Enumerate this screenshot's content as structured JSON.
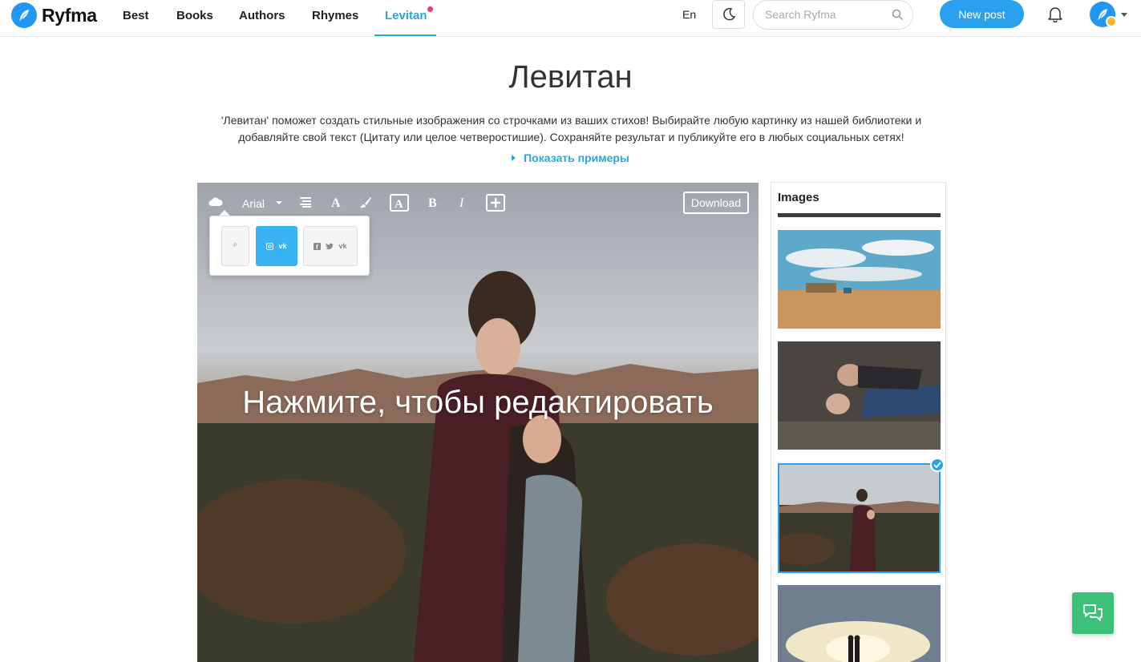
{
  "brand": {
    "name": "Ryfma",
    "accent": "#2aa1ee"
  },
  "nav": {
    "items": [
      {
        "label": "Best"
      },
      {
        "label": "Books"
      },
      {
        "label": "Authors"
      },
      {
        "label": "Rhymes"
      },
      {
        "label": "Levitan"
      }
    ],
    "active": "Levitan",
    "active_color": "#2aa7d9"
  },
  "header": {
    "lang_label": "En",
    "search_placeholder": "Search Ryfma",
    "new_post_label": "New post"
  },
  "page": {
    "title": "Левитан",
    "intro": "'Левитан' поможет создать стильные изображения со строчками из ваших стихов! Выбирайте любую картинку из нашей библиотеки и добавляйте свой текст (Цитату или целое четверостишие). Сохраняйте результат и публикуйте его в любых социальных сетях!",
    "examples_label": "Показать примеры"
  },
  "editor": {
    "font_label": "Arial",
    "download_label": "Download",
    "overlay_text": "Нажмите, чтобы редактировать",
    "toolbar_icons": [
      "cloud-icon",
      "align-icon",
      "text-size-icon",
      "brush-icon",
      "text-box-icon",
      "bold-icon",
      "italic-icon",
      "add-icon"
    ],
    "format_options": [
      {
        "name": "pinterest",
        "icons": [
          "pinterest-icon"
        ]
      },
      {
        "name": "instagram-vk",
        "icons": [
          "instagram-icon",
          "vk-icon"
        ],
        "selected": true
      },
      {
        "name": "facebook-twitter-vk",
        "icons": [
          "facebook-icon",
          "twitter-icon",
          "vk-icon"
        ]
      }
    ]
  },
  "images_panel": {
    "title": "Images",
    "selected_index": 2
  }
}
